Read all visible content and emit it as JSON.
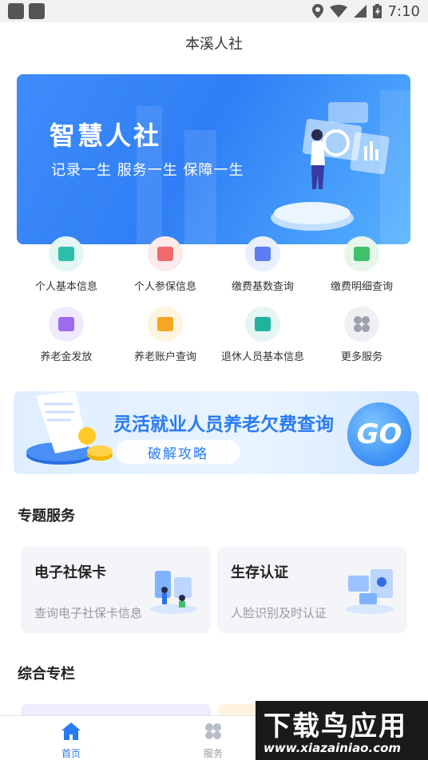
{
  "status_bar": {
    "time": "7:10"
  },
  "header": {
    "title": "本溪人社"
  },
  "banner": {
    "headline": "智慧人社",
    "slogan": "记录一生  服务一生  保障一生"
  },
  "services": [
    {
      "label": "个人基本信息",
      "icon": "id-card-icon",
      "bg": "#e3f6f4",
      "fg": "#2bbfa9"
    },
    {
      "label": "个人参保信息",
      "icon": "document-icon",
      "bg": "#fdeaea",
      "fg": "#f06a6a"
    },
    {
      "label": "缴费基数查询",
      "icon": "payment-base-icon",
      "bg": "#e8efff",
      "fg": "#5b7cf2"
    },
    {
      "label": "缴费明细查询",
      "icon": "receipt-icon",
      "bg": "#e6f7ea",
      "fg": "#3fc06b"
    },
    {
      "label": "养老金发放",
      "icon": "pension-icon",
      "bg": "#f1eafe",
      "fg": "#9b6cf0"
    },
    {
      "label": "养老账户查询",
      "icon": "account-icon",
      "bg": "#fff3e2",
      "fg": "#f5a623"
    },
    {
      "label": "退休人员基本信息",
      "icon": "retiree-card-icon",
      "bg": "#e3f6f4",
      "fg": "#22b39f"
    },
    {
      "label": "更多服务",
      "icon": "more-grid-icon",
      "bg": "#eef0f4",
      "fg": "#9aa1ad"
    }
  ],
  "promo": {
    "title": "灵活就业人员养老欠费查询",
    "button": "破解攻略",
    "go": "GO"
  },
  "special": {
    "title": "专题服务",
    "cards": [
      {
        "title": "电子社保卡",
        "subtitle": "查询电子社保卡信息",
        "icon": "social-card-illustration"
      },
      {
        "title": "生存认证",
        "subtitle": "人脸识别及时认证",
        "icon": "face-auth-illustration"
      }
    ]
  },
  "column": {
    "title": "综合专栏"
  },
  "tabbar": {
    "active_color": "#2a7bf2",
    "items": [
      {
        "label": "首页",
        "icon": "home-icon"
      },
      {
        "label": "服务",
        "icon": "services-grid-icon"
      }
    ]
  },
  "watermark": {
    "line1": "下载鸟应用",
    "line2": "www.xiazainiao.com"
  }
}
